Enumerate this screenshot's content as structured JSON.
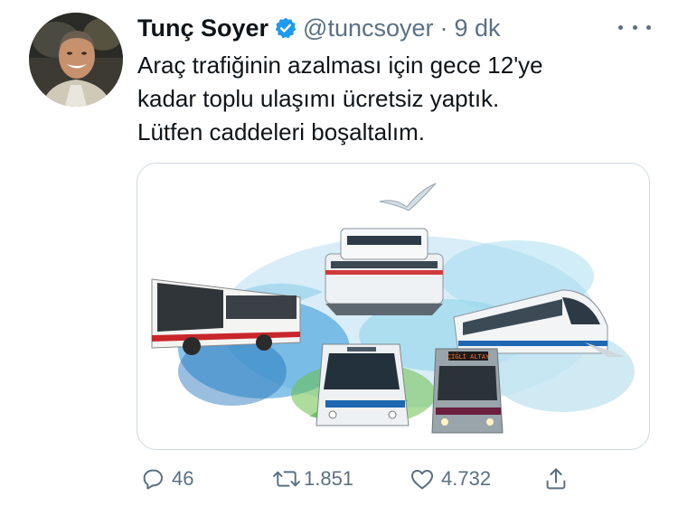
{
  "author": {
    "name": "Tunç Soyer",
    "handle": "@tuncsoyer",
    "separator": "·",
    "time": "9 dk",
    "verified_color": "#1d9bf0"
  },
  "tweet": {
    "lines": [
      "Araç trafiğinin azalması için gece 12'ye",
      "kadar toplu ulaşımı ücretsiz yaptık.",
      "Lütfen caddeleri boşaltalım."
    ]
  },
  "media": {
    "tram_sign": "ÇİĞLİ ALTAY"
  },
  "actions": {
    "reply_count": "46",
    "retweet_count": "1.851",
    "like_count": "4.732"
  },
  "icons": {
    "reply": "comment-icon",
    "retweet": "retweet-icon",
    "like": "heart-icon",
    "share": "share-icon",
    "more": "more-dots-icon",
    "verified": "verified-badge-icon"
  },
  "colors": {
    "text": "#0f1419",
    "secondary": "#5b7083",
    "border": "#cfd9de"
  }
}
